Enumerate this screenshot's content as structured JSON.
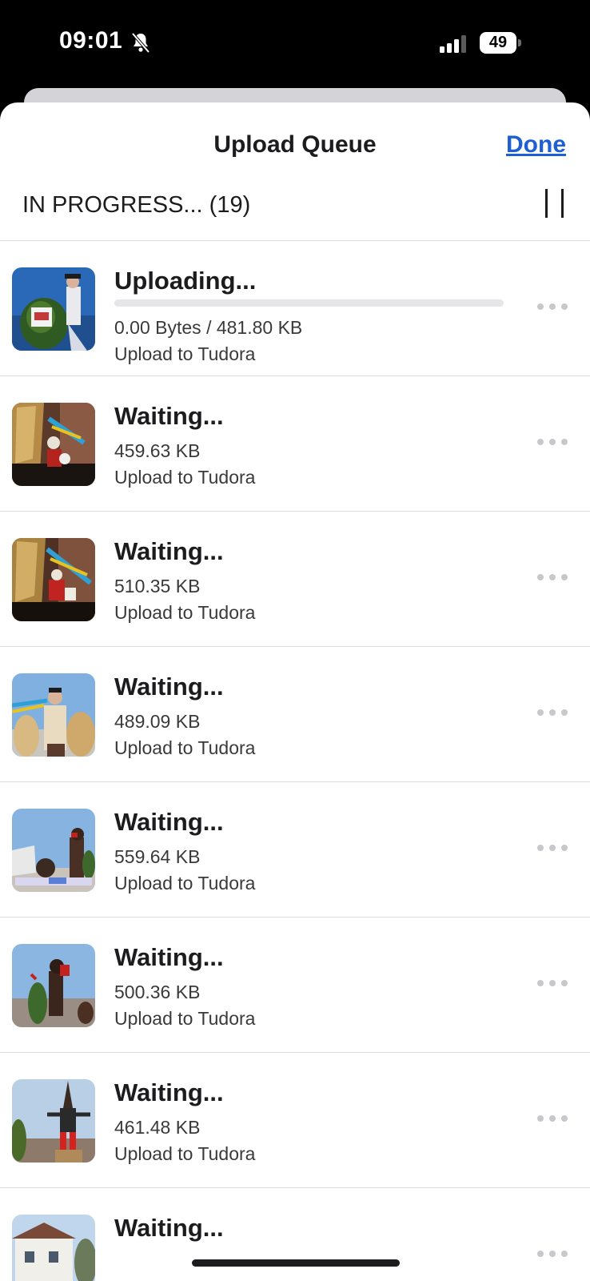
{
  "status_bar": {
    "time": "09:01",
    "battery": "49",
    "silent_icon": "bell-slash-icon",
    "signal_icon": "cellular-signal-icon"
  },
  "sheet": {
    "title": "Upload Queue",
    "done_label": "Done",
    "accent_color": "#1f5fd6"
  },
  "section": {
    "label": "IN PROGRESS... (19)",
    "pause_icon": "pause-icon"
  },
  "items": [
    {
      "status": "Uploading...",
      "size": "0.00 Bytes / 481.80 KB",
      "destination": "Upload to Tudora",
      "progress": 0
    },
    {
      "status": "Waiting...",
      "size": "459.63 KB",
      "destination": "Upload to Tudora"
    },
    {
      "status": "Waiting...",
      "size": "510.35 KB",
      "destination": "Upload to Tudora"
    },
    {
      "status": "Waiting...",
      "size": "489.09 KB",
      "destination": "Upload to Tudora"
    },
    {
      "status": "Waiting...",
      "size": "559.64 KB",
      "destination": "Upload to Tudora"
    },
    {
      "status": "Waiting...",
      "size": "500.36 KB",
      "destination": "Upload to Tudora"
    },
    {
      "status": "Waiting...",
      "size": "461.48 KB",
      "destination": "Upload to Tudora"
    },
    {
      "status": "Waiting...",
      "size": "",
      "destination": ""
    }
  ]
}
